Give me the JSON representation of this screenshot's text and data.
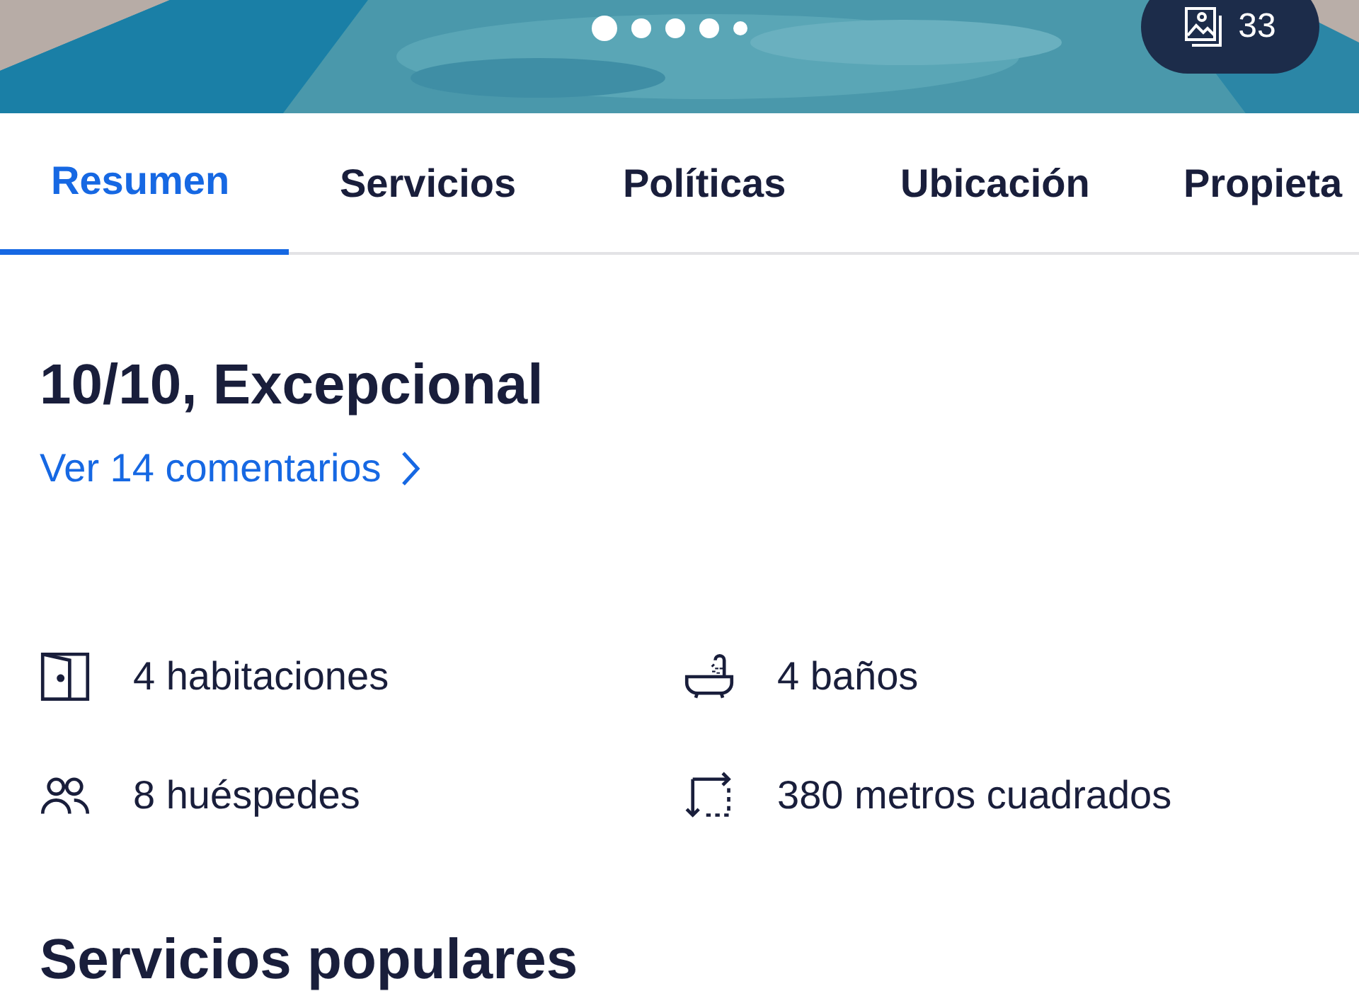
{
  "gallery": {
    "dots": [
      {
        "selected": true
      },
      {
        "selected": false
      },
      {
        "selected": false
      },
      {
        "selected": false
      },
      {
        "selected": false
      }
    ],
    "photo_count": "33"
  },
  "tabs": [
    {
      "label": "Resumen",
      "selected": true
    },
    {
      "label": "Servicios",
      "selected": false
    },
    {
      "label": "Políticas",
      "selected": false
    },
    {
      "label": "Ubicación",
      "selected": false
    },
    {
      "label": "Propieta",
      "selected": false
    }
  ],
  "rating": {
    "title": "10/10, Excepcional",
    "reviews_link": "Ver 14 comentarios"
  },
  "features": [
    {
      "kind": "door",
      "text": "4 habitaciones"
    },
    {
      "kind": "bath",
      "text": "4 baños"
    },
    {
      "kind": "guests",
      "text": "8 huéspedes"
    },
    {
      "kind": "area",
      "text": "380 metros cuadrados"
    }
  ],
  "section_heading": "Servicios populares"
}
